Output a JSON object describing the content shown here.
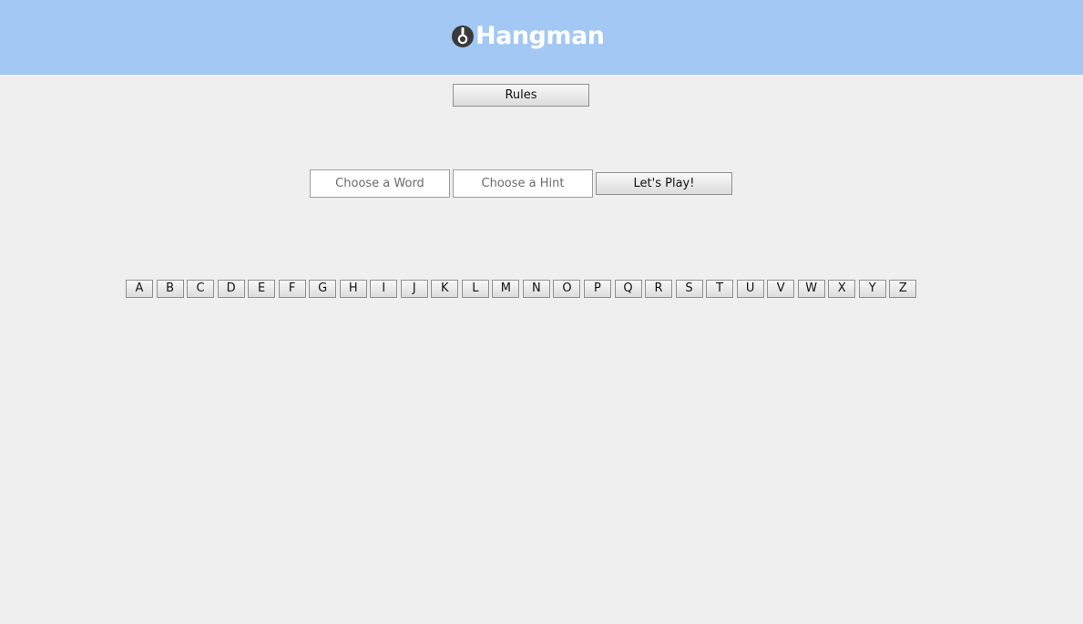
{
  "header": {
    "title": "Hangman",
    "logo_icon": "noose-icon",
    "background_color": "#a2c8f3"
  },
  "rules_button": {
    "label": "Rules"
  },
  "setup": {
    "word_placeholder": "Choose a Word",
    "word_value": "",
    "hint_placeholder": "Choose a Hint",
    "hint_value": "",
    "play_label": "Let's Play!"
  },
  "letters": [
    "A",
    "B",
    "C",
    "D",
    "E",
    "F",
    "G",
    "H",
    "I",
    "J",
    "K",
    "L",
    "M",
    "N",
    "O",
    "P",
    "Q",
    "R",
    "S",
    "T",
    "U",
    "V",
    "W",
    "X",
    "Y",
    "Z"
  ]
}
